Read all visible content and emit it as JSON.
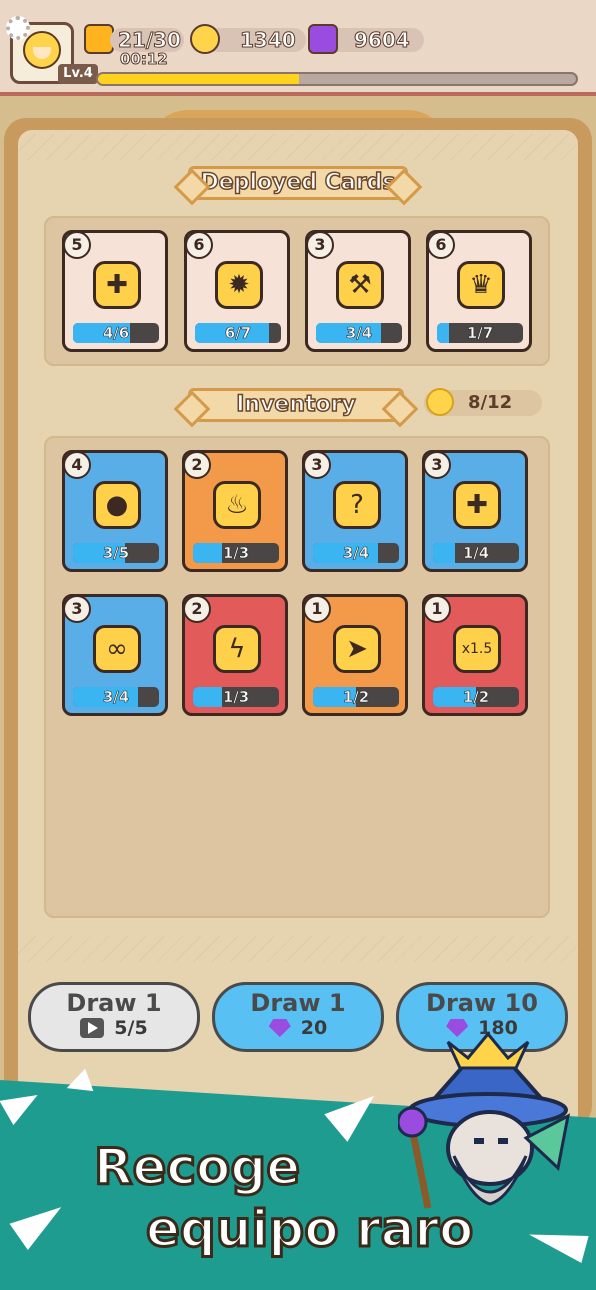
{
  "top_bar": {
    "level": "Lv.4",
    "xp_progress": 0.42,
    "energy": "21/30",
    "energy_timer": "00:12",
    "coins": "1340",
    "gems": "9604"
  },
  "deployed": {
    "title": "Deployed Cards",
    "cards": [
      {
        "cost": "5",
        "progress_text": "4/6",
        "progress": 0.667,
        "icon": "shield-plus-icon",
        "color": "beige"
      },
      {
        "cost": "6",
        "progress_text": "6/7",
        "progress": 0.857,
        "icon": "gear-wreath-icon",
        "color": "beige"
      },
      {
        "cost": "3",
        "progress_text": "3/4",
        "progress": 0.75,
        "icon": "hammer-upgrade-icon",
        "color": "beige"
      },
      {
        "cost": "6",
        "progress_text": "1/7",
        "progress": 0.143,
        "icon": "level-up-crown-icon",
        "color": "beige"
      }
    ]
  },
  "inventory": {
    "title": "Inventory",
    "count": "8/12",
    "cards": [
      {
        "cost": "4",
        "progress_text": "3/5",
        "progress": 0.6,
        "icon": "coin-bag-icon",
        "color": "blue"
      },
      {
        "cost": "2",
        "progress_text": "1/3",
        "progress": 0.333,
        "icon": "fire-spirit-icon",
        "color": "orange"
      },
      {
        "cost": "3",
        "progress_text": "3/4",
        "progress": 0.75,
        "icon": "mystery-figure-icon",
        "color": "blue"
      },
      {
        "cost": "3",
        "progress_text": "1/4",
        "progress": 0.25,
        "icon": "heal-drop-icon",
        "color": "blue"
      },
      {
        "cost": "3",
        "progress_text": "3/4",
        "progress": 0.75,
        "icon": "chain-lightning-icon",
        "color": "blue"
      },
      {
        "cost": "2",
        "progress_text": "1/3",
        "progress": 0.333,
        "icon": "lightning-icon",
        "color": "red"
      },
      {
        "cost": "1",
        "progress_text": "1/2",
        "progress": 0.5,
        "icon": "dash-figure-icon",
        "color": "orange"
      },
      {
        "cost": "1",
        "progress_text": "1/2",
        "progress": 0.5,
        "icon": "speed-x15-icon",
        "color": "red",
        "art_text": "x1.5"
      }
    ]
  },
  "draw_buttons": [
    {
      "label": "Draw 1",
      "cost": "5/5",
      "cost_icon": "video-ad-icon",
      "style": "grey"
    },
    {
      "label": "Draw 1",
      "cost": "20",
      "cost_icon": "gem-icon",
      "style": "blue"
    },
    {
      "label": "Draw 10",
      "cost": "180",
      "cost_icon": "gem-icon",
      "style": "blue"
    }
  ],
  "promo": {
    "line1": "Recoge",
    "line2": "equipo raro"
  },
  "colors": {
    "blue_card": "#5aaee7",
    "orange_card": "#f29a4a",
    "red_card": "#e35a5a",
    "beige_card": "#f6e2d6",
    "progress": "#3ab5f2",
    "promo_bg": "#1f9c90"
  }
}
